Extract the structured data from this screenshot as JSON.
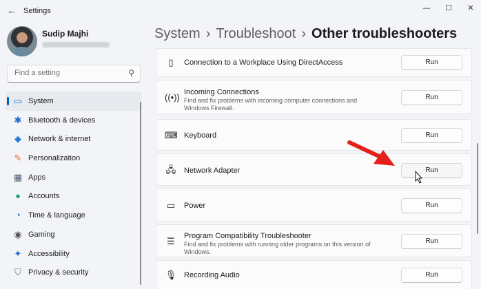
{
  "app": {
    "title": "Settings"
  },
  "user": {
    "name": "Sudip Majhi"
  },
  "search": {
    "placeholder": "Find a setting"
  },
  "nav": [
    {
      "label": "System",
      "icon": "monitor-icon"
    },
    {
      "label": "Bluetooth & devices",
      "icon": "bluetooth-icon"
    },
    {
      "label": "Network & internet",
      "icon": "wifi-icon"
    },
    {
      "label": "Personalization",
      "icon": "brush-icon"
    },
    {
      "label": "Apps",
      "icon": "apps-icon"
    },
    {
      "label": "Accounts",
      "icon": "person-icon"
    },
    {
      "label": "Time & language",
      "icon": "globe-clock-icon"
    },
    {
      "label": "Gaming",
      "icon": "gamepad-icon"
    },
    {
      "label": "Accessibility",
      "icon": "accessibility-icon"
    },
    {
      "label": "Privacy & security",
      "icon": "shield-icon"
    }
  ],
  "nav_active": "System",
  "breadcrumb": {
    "part1": "System",
    "part2": "Troubleshoot",
    "current": "Other troubleshooters",
    "sep": "›"
  },
  "troubleshooters": [
    {
      "title": "Connection to a Workplace Using DirectAccess",
      "description": "",
      "icon": "phone-icon",
      "button": "Run"
    },
    {
      "title": "Incoming Connections",
      "description": "Find and fix problems with incoming computer connections and Windows Firewall.",
      "icon": "antenna-icon",
      "button": "Run"
    },
    {
      "title": "Keyboard",
      "description": "",
      "icon": "keyboard-icon",
      "button": "Run"
    },
    {
      "title": "Network Adapter",
      "description": "",
      "icon": "network-adapter-icon",
      "button": "Run"
    },
    {
      "title": "Power",
      "description": "",
      "icon": "battery-icon",
      "button": "Run"
    },
    {
      "title": "Program Compatibility Troubleshooter",
      "description": "Find and fix problems with running older programs on this version of Windows.",
      "icon": "list-icon",
      "button": "Run"
    },
    {
      "title": "Recording Audio",
      "description": "",
      "icon": "microphone-icon",
      "button": "Run"
    }
  ],
  "colors": {
    "accent": "#005fb8",
    "arrow": "#e5201b",
    "background": "#f2f4f8"
  }
}
